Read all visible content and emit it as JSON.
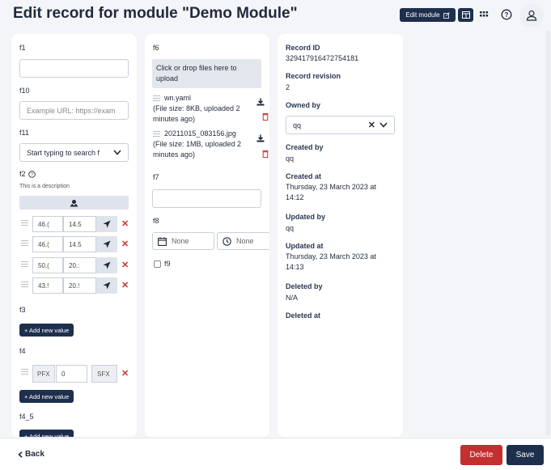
{
  "header": {
    "title": "Edit record for module \"Demo Module\"",
    "edit_module_label": "Edit module"
  },
  "col1": {
    "f1_label": "f1",
    "f1_value": "",
    "f10_label": "f10",
    "f10_placeholder": "Example URL: https://exam",
    "f11_label": "f11",
    "f11_placeholder": "Start typing to search f",
    "f2_label": "f2",
    "f2_description": "This is a description",
    "coordinates": [
      {
        "lat": "46.(",
        "lng": "14.5"
      },
      {
        "lat": "46.(",
        "lng": "14.5"
      },
      {
        "lat": "50.(",
        "lng": "20.:"
      },
      {
        "lat": "43.!",
        "lng": "20.!"
      }
    ],
    "f3_label": "f3",
    "add_new_value_label": "+ Add new value",
    "f4_label": "f4",
    "f4_prefix": "PFX",
    "f4_value": "0",
    "f4_suffix": "SFX",
    "f4_5_label": "f4_5"
  },
  "col2": {
    "f6_label": "f6",
    "dropzone_text": "Click or drop files here to upload",
    "files": [
      {
        "name": "wn.yaml",
        "info": "(File size: 8KB, uploaded 2 minutes ago)"
      },
      {
        "name": "20211015_083156.jpg",
        "info": "(File size: 1MB, uploaded 2 minutes ago)"
      }
    ],
    "f7_label": "f7",
    "f7_value": "",
    "f8_label": "f8",
    "date_none": "None",
    "time_none": "None",
    "f9_label": "f9"
  },
  "col3": {
    "record_id_label": "Record ID",
    "record_id": "329417916472754181",
    "record_revision_label": "Record revision",
    "record_revision": "2",
    "owned_by_label": "Owned by",
    "owned_by": "qq",
    "created_by_label": "Created by",
    "created_by": "qq",
    "created_at_label": "Created at",
    "created_at": "Thursday, 23 March 2023 at 14:12",
    "updated_by_label": "Updated by",
    "updated_by": "qq",
    "updated_at_label": "Updated at",
    "updated_at": "Thursday, 23 March 2023 at 14:13",
    "deleted_by_label": "Deleted by",
    "deleted_by": "N/A",
    "deleted_at_label": "Deleted at"
  },
  "footer": {
    "back_label": "Back",
    "delete_label": "Delete",
    "save_label": "Save"
  },
  "colors": {
    "primary": "#1e2f4d",
    "danger": "#c42f2f"
  }
}
